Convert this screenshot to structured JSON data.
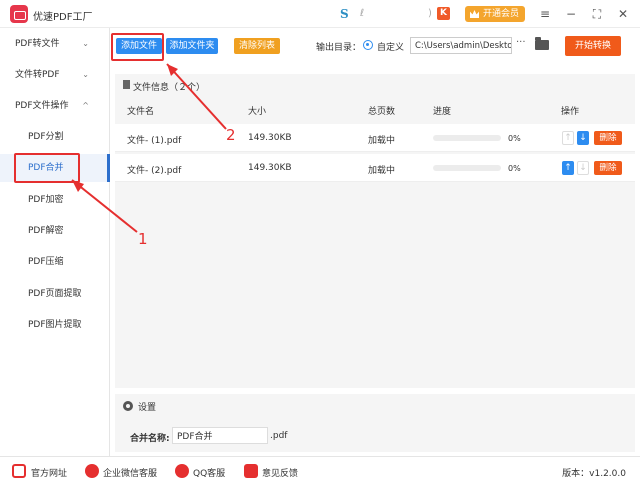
{
  "app": {
    "title": "优速PDF工厂",
    "logo_mark": "S",
    "titlebar_marks": [
      "ℓ",
      ")"
    ],
    "titlebar_badge": "K",
    "vip_label": "开通会员",
    "window_buttons": [
      "≡",
      "−",
      "⛶",
      "✕"
    ]
  },
  "sidebar": {
    "items": [
      {
        "label": "PDF转文件",
        "chevron": "⌄",
        "level": "top"
      },
      {
        "label": "文件转PDF",
        "chevron": "⌄",
        "level": "top"
      },
      {
        "label": "PDF文件操作",
        "chevron": "^",
        "level": "top"
      },
      {
        "label": "PDF分割",
        "level": "sub"
      },
      {
        "label": "PDF合并",
        "level": "sub",
        "active": true
      },
      {
        "label": "PDF加密",
        "level": "sub"
      },
      {
        "label": "PDF解密",
        "level": "sub"
      },
      {
        "label": "PDF压缩",
        "level": "sub"
      },
      {
        "label": "PDF页面提取",
        "level": "sub"
      },
      {
        "label": "PDF图片提取",
        "level": "sub"
      }
    ]
  },
  "toolbar": {
    "add_file": "添加文件",
    "add_folder": "添加文件夹",
    "clear_list": "清除列表",
    "output_label": "输出目录：",
    "custom_label": "自定义",
    "output_path": "C:\\Users\\admin\\Deskto",
    "more": "···",
    "start": "开始转换"
  },
  "file_panel": {
    "header": "文件信息（２个）",
    "columns": [
      "文件名",
      "大小",
      "总页数",
      "进度",
      "操作"
    ],
    "rows": [
      {
        "name": "文件- (1).pdf",
        "size": "149.30KB",
        "pages": "加载中",
        "progress": 0,
        "progress_text": "0%",
        "up_enabled": false,
        "down_enabled": true,
        "delete": "删除"
      },
      {
        "name": "文件- (2).pdf",
        "size": "149.30KB",
        "pages": "加载中",
        "progress": 0,
        "progress_text": "0%",
        "up_enabled": true,
        "down_enabled": false,
        "delete": "删除"
      }
    ]
  },
  "settings": {
    "title": "设置",
    "merge_name_label": "合并名称:",
    "merge_name_value": "PDF合并",
    "merge_ext": ".pdf"
  },
  "footer": {
    "links": [
      "官方网址",
      "企业微信客服",
      "QQ客服",
      "意见反馈"
    ],
    "version": "版本：v1.2.0.0"
  },
  "annotations": {
    "marker_1": "1",
    "marker_2": "2",
    "color": "#e52f2f"
  },
  "colors": {
    "primary": "#2d8cf0",
    "danger": "#f05a1a",
    "vip": "#f4a52d",
    "clear": "#f0a020"
  }
}
